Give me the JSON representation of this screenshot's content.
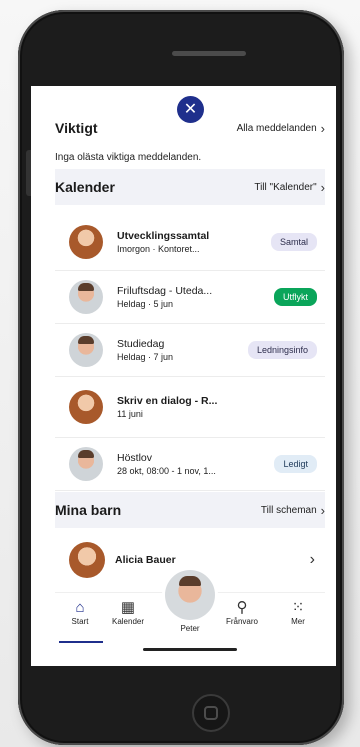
{
  "viktigt": {
    "title": "Viktigt",
    "link": "Alla meddelanden",
    "empty_notice": "Inga olästa viktiga meddelanden."
  },
  "kalender": {
    "title": "Kalender",
    "link": "Till \"Kalender\"",
    "events": [
      {
        "title": "Utvecklingssamtal",
        "subtitle": "Imorgon · Kontoret...",
        "tag": "Samtal",
        "bold": true
      },
      {
        "title": "Friluftsdag - Uteda...",
        "subtitle": "Heldag · 5 jun",
        "tag": "Utflykt",
        "bold": false
      },
      {
        "title": "Studiedag",
        "subtitle": "Heldag · 7 jun",
        "tag": "Ledningsinfo",
        "bold": false
      },
      {
        "title": "Skriv en dialog - R...",
        "subtitle": "11 juni",
        "tag": "",
        "bold": true
      },
      {
        "title": "Höstlov",
        "subtitle": "28 okt, 08:00 - 1 nov, 1...",
        "tag": "Ledigt",
        "bold": false
      }
    ]
  },
  "mina_barn": {
    "title": "Mina barn",
    "link": "Till scheman",
    "children": [
      {
        "name": "Alicia Bauer"
      }
    ]
  },
  "tabbar": {
    "tabs": [
      {
        "label": "Start",
        "icon": "home-icon",
        "active": true
      },
      {
        "label": "Kalender",
        "icon": "calendar-icon",
        "active": false
      },
      {
        "label": "Peter",
        "icon": "avatar",
        "active": false
      },
      {
        "label": "Frånvaro",
        "icon": "absence-icon",
        "active": false
      },
      {
        "label": "Mer",
        "icon": "grid-icon",
        "active": false
      }
    ]
  },
  "colors": {
    "accent": "#1f2f8c",
    "tag_green": "#0aa55a",
    "tag_purple": "#e6e5f5",
    "tag_blue": "#e1ecf6"
  }
}
